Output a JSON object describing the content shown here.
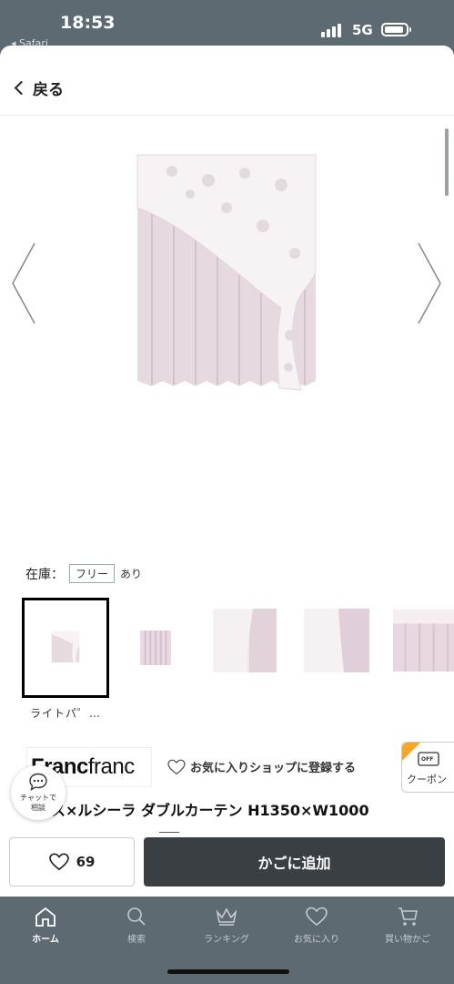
{
  "status_bar": {
    "time": "18:53",
    "back_app": "◂ Safari",
    "network": "5G"
  },
  "nav": {
    "back_label": "戻る"
  },
  "gallery": {
    "prev_icon": "chevron-left-icon",
    "next_icon": "chevron-right-icon"
  },
  "stock": {
    "label": "在庫：",
    "size": "フリー",
    "availability": "あり"
  },
  "thumbnails": {
    "selected_caption": "ライトパ゜…"
  },
  "shop": {
    "logo_bold": "Franc",
    "logo_light": "franc",
    "favorite_label": "お気に入りショップに登録する"
  },
  "coupon": {
    "label": "クーポン",
    "icon_text": "OFF"
  },
  "product": {
    "title": "ス×ルシーラ ダブルカーテン H1350×W1000"
  },
  "chat": {
    "line1": "チャットで",
    "line2": "相談"
  },
  "actions": {
    "like_count": "69",
    "add_to_cart": "かごに追加"
  },
  "tabbar": {
    "items": [
      {
        "label": "ホーム",
        "icon": "home-icon"
      },
      {
        "label": "検索",
        "icon": "search-icon"
      },
      {
        "label": "ランキング",
        "icon": "crown-icon"
      },
      {
        "label": "お気に入り",
        "icon": "heart-icon"
      },
      {
        "label": "買い物かご",
        "icon": "cart-icon"
      }
    ]
  },
  "colors": {
    "status_bg": "#5e6a72",
    "curtain_pink": "#e6d9e0",
    "cart_button": "#3a3f44",
    "coupon_accent": "#f5a623"
  }
}
